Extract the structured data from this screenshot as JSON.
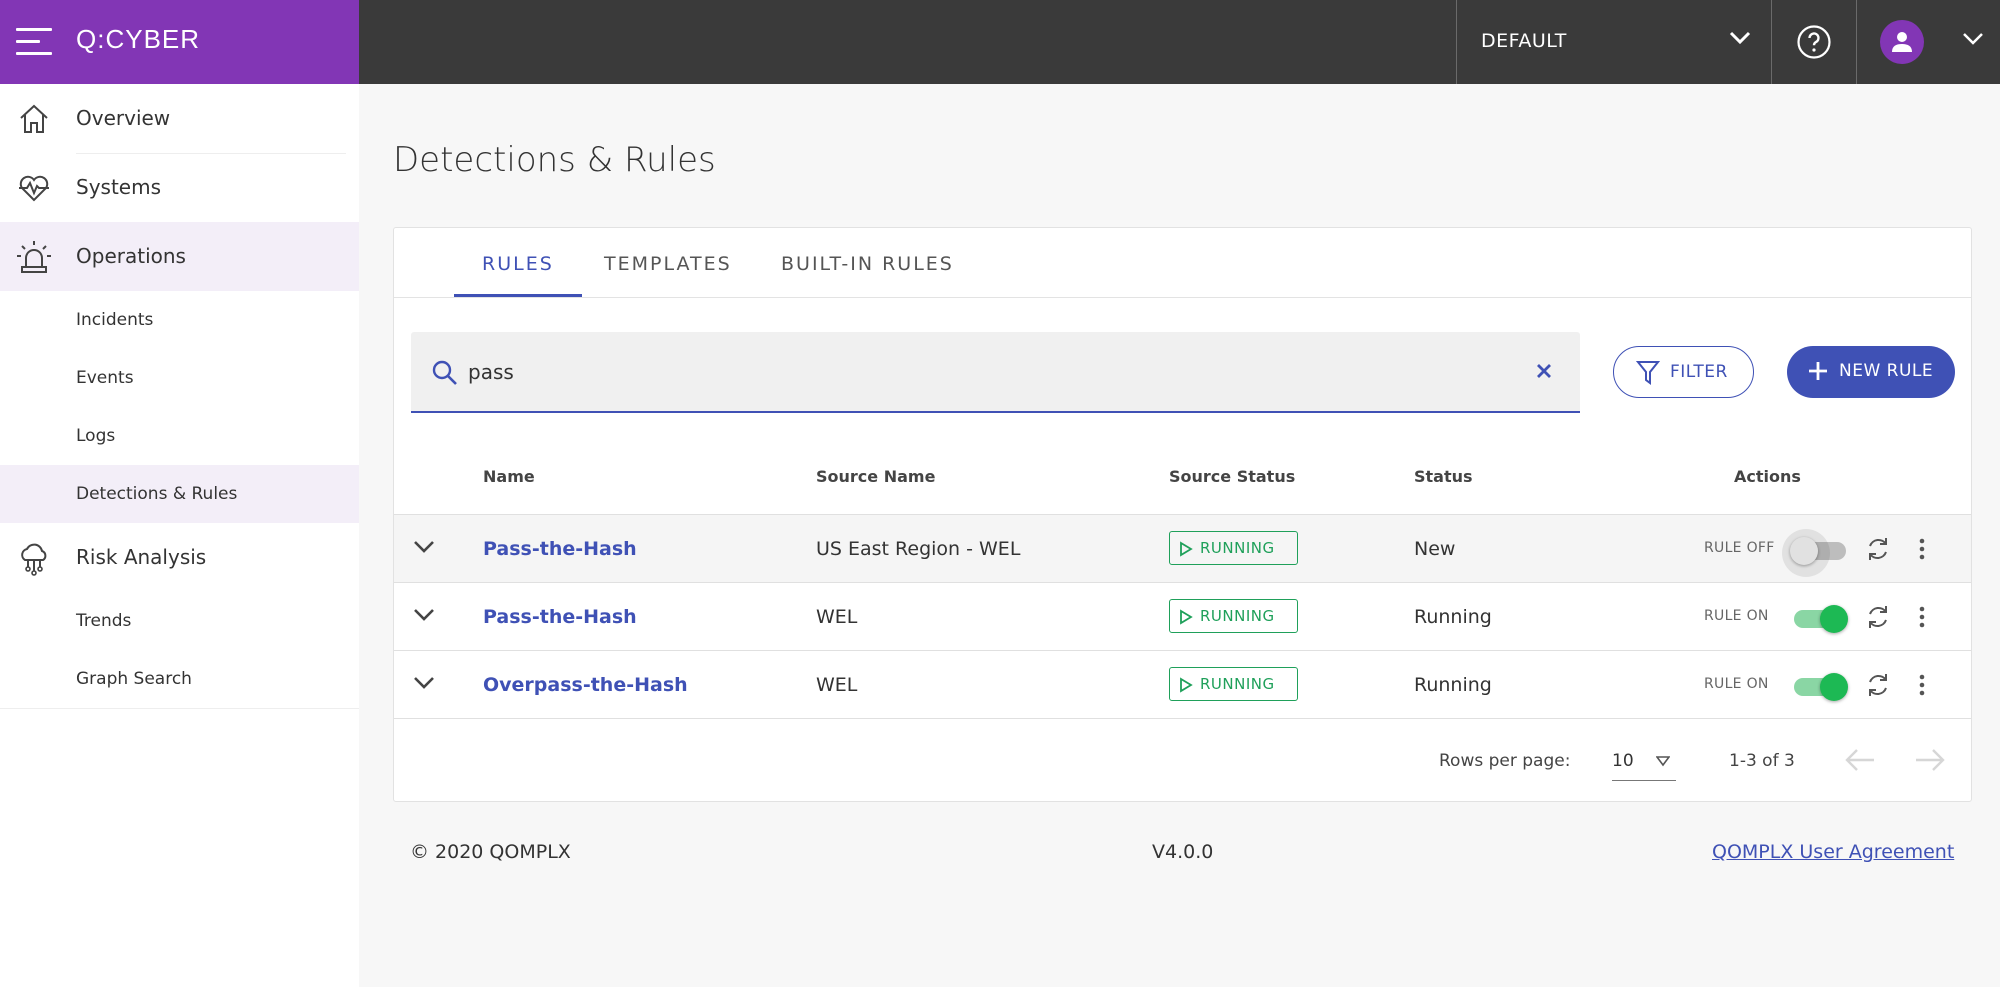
{
  "app": {
    "brand": "Q:CYBER"
  },
  "header": {
    "workspace": "DEFAULT"
  },
  "colors": {
    "brand": "#8236b5",
    "accent": "#3f51b5",
    "running": "#1fa05a",
    "toggle_on": "#1db954"
  },
  "sidebar": {
    "items": [
      {
        "label": "Overview",
        "icon": "home-icon"
      },
      {
        "label": "Systems",
        "icon": "heartbeat-icon"
      },
      {
        "label": "Operations",
        "icon": "alarm-icon",
        "selected": true,
        "children": [
          {
            "label": "Incidents"
          },
          {
            "label": "Events"
          },
          {
            "label": "Logs"
          },
          {
            "label": "Detections & Rules",
            "selected": true
          }
        ]
      },
      {
        "label": "Risk Analysis",
        "icon": "cloud-network-icon",
        "children": [
          {
            "label": "Trends"
          },
          {
            "label": "Graph Search"
          }
        ]
      }
    ]
  },
  "page": {
    "title": "Detections & Rules"
  },
  "tabs": [
    {
      "label": "RULES",
      "active": true
    },
    {
      "label": "TEMPLATES"
    },
    {
      "label": "BUILT-IN RULES"
    }
  ],
  "search": {
    "value": "pass"
  },
  "buttons": {
    "filter": "FILTER",
    "new_rule": "NEW RULE"
  },
  "table": {
    "headers": {
      "name": "Name",
      "source_name": "Source Name",
      "source_status": "Source Status",
      "status": "Status",
      "actions": "Actions"
    },
    "rows": [
      {
        "name": "Pass-the-Hash",
        "source_name": "US East Region - WEL",
        "source_status": "RUNNING",
        "status": "New",
        "rule_toggle": "RULE OFF",
        "enabled": false
      },
      {
        "name": "Pass-the-Hash",
        "source_name": "WEL",
        "source_status": "RUNNING",
        "status": "Running",
        "rule_toggle": "RULE ON",
        "enabled": true
      },
      {
        "name": "Overpass-the-Hash",
        "source_name": "WEL",
        "source_status": "RUNNING",
        "status": "Running",
        "rule_toggle": "RULE ON",
        "enabled": true
      }
    ]
  },
  "pagination": {
    "rows_per_page_label": "Rows per page:",
    "rows_per_page": "10",
    "range": "1-3 of 3"
  },
  "footer": {
    "copyright": "© 2020 QOMPLX",
    "version": "V4.0.0",
    "agreement": "QOMPLX User Agreement"
  }
}
